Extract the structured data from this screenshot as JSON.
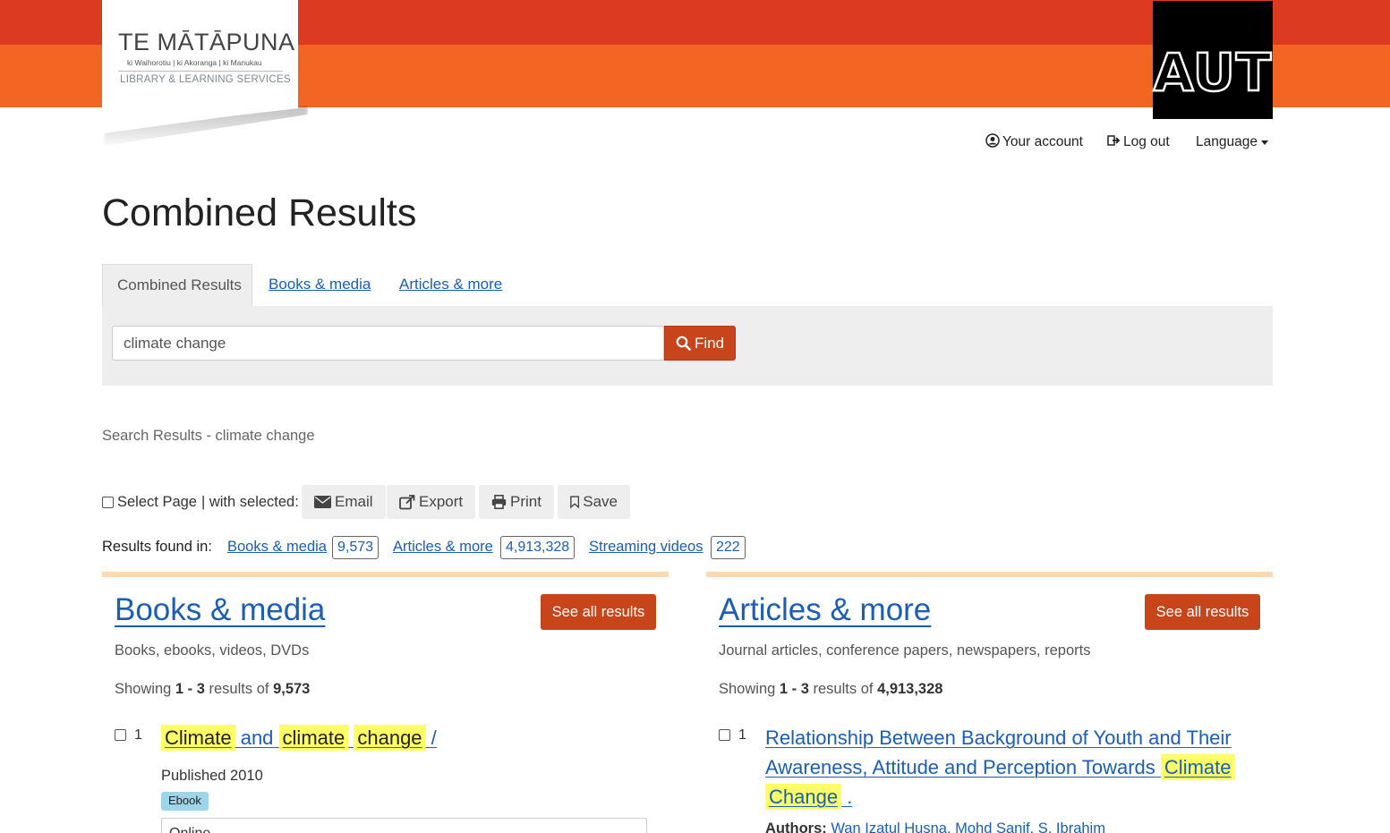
{
  "logo": {
    "title": "TE MĀTĀPUNA",
    "subtitle": "ki Waihorotiu | ki Akoranga | ki Manukau",
    "tagline": "LIBRARY & LEARNING SERVICES"
  },
  "brand": {
    "name": "AUT",
    "band_top_color": "#dc3b22",
    "band_bottom_color": "#f26522",
    "accent_button": "#c8441a",
    "link_color": "#1a5fb4"
  },
  "account_nav": {
    "your_account": "Your account",
    "log_out": "Log out",
    "language": "Language"
  },
  "page_title": "Combined Results",
  "tabs": [
    {
      "label": "Combined Results",
      "active": true
    },
    {
      "label": "Books & media",
      "active": false
    },
    {
      "label": "Articles & more",
      "active": false
    }
  ],
  "search": {
    "value": "climate change",
    "find_label": "Find"
  },
  "results_heading": "Search Results - climate change",
  "toolbar": {
    "select_page": "Select Page",
    "with_selected": "| with selected:",
    "email": "Email",
    "export": "Export",
    "print": "Print",
    "save": "Save"
  },
  "results_found": {
    "label": "Results found in:",
    "sources": [
      {
        "name": "Books & media",
        "count": "9,573"
      },
      {
        "name": "Articles & more",
        "count": "4,913,328"
      },
      {
        "name": "Streaming videos",
        "count": "222"
      }
    ]
  },
  "columns": {
    "books": {
      "title": "Books & media",
      "see_all": "See all results",
      "description": "Books, ebooks, videos, DVDs",
      "showing_prefix": "Showing",
      "range": "1 - 3",
      "results_of": "results of",
      "total": "9,573",
      "record": {
        "number": "1",
        "title_parts": [
          "Climate",
          "and",
          "climate",
          "change",
          "/"
        ],
        "published": "Published 2010",
        "format": "Ebook",
        "online": "Online"
      }
    },
    "articles": {
      "title": "Articles & more",
      "see_all": "See all results",
      "description": "Journal articles, conference papers, newspapers, reports",
      "showing_prefix": "Showing",
      "range": "1 - 3",
      "results_of": "results of",
      "total": "4,913,328",
      "record": {
        "number": "1",
        "title_line1": "Relationship Between Background of Youth and Their",
        "title_line2": "Awareness, Attitude and Perception Towards",
        "title_hl1": "Climate",
        "title_hl2": "Change",
        "title_end": ".",
        "authors_label": "Authors:",
        "authors": "Wan Izatul Husna, Mohd Sanif, S. Ibrahim"
      }
    }
  }
}
